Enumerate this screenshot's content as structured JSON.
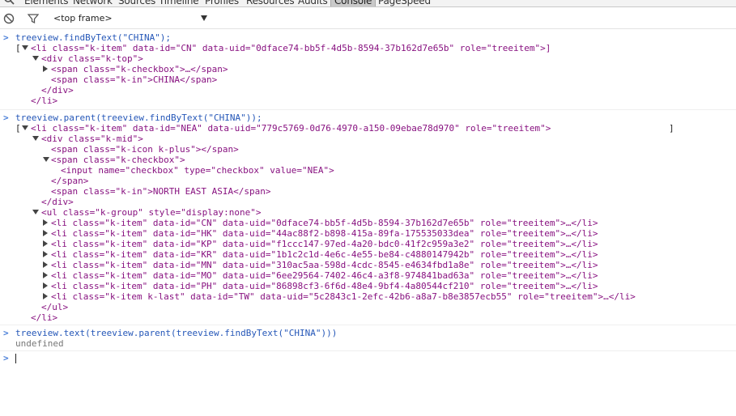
{
  "tabs": [
    "Elements",
    "Network",
    "Sources",
    "Timeline",
    "Profiles",
    "Resources",
    "Audits",
    "Console",
    "PageSpeed"
  ],
  "active_tab": "Console",
  "toolbar": {
    "frame_select_value": "<top frame>"
  },
  "console": {
    "prompt_symbol": ">",
    "command1": "treeview.findByText(\"CHINA\");",
    "command2": "treeview.parent(treeview.findByText(\"CHINA\"));",
    "command3": "treeview.text(treeview.parent(treeview.findByText(\"CHINA\")))",
    "result3": "undefined",
    "open_bracket": "[",
    "close_bracket": "]",
    "tree1": {
      "li_open": "<li class=\"k-item\" data-id=\"CN\" data-uid=\"0dface74-bb5f-4d5b-8594-37b162d7e65b\" role=\"treeitem\">]",
      "div_open": "<div class=\"k-top\">",
      "checkbox_collapsed": "<span class=\"k-checkbox\">…</span>",
      "span_in": "<span class=\"k-in\">CHINA</span>",
      "div_close": "</div>",
      "li_close": "</li>"
    },
    "tree2": {
      "li_open": "<li class=\"k-item\" data-id=\"NEA\" data-uid=\"779c5769-0d76-4970-a150-09ebae78d970\" role=\"treeitem\">",
      "div_open": "<div class=\"k-mid\">",
      "span_icon": "<span class=\"k-icon k-plus\"></span>",
      "span_checkbox_open": "<span class=\"k-checkbox\">",
      "input": "<input name=\"checkbox\" type=\"checkbox\" value=\"NEA\">",
      "span_close": "</span>",
      "span_in": "<span class=\"k-in\">NORTH EAST ASIA</span>",
      "div_close": "</div>",
      "ul_open": "<ul class=\"k-group\" style=\"display:none\">",
      "children": [
        "<li class=\"k-item\" data-id=\"CN\" data-uid=\"0dface74-bb5f-4d5b-8594-37b162d7e65b\" role=\"treeitem\">…</li>",
        "<li class=\"k-item\" data-id=\"HK\" data-uid=\"44ac88f2-b898-415a-89fa-175535033dea\" role=\"treeitem\">…</li>",
        "<li class=\"k-item\" data-id=\"KP\" data-uid=\"f1ccc147-97ed-4a20-bdc0-41f2c959a3e2\" role=\"treeitem\">…</li>",
        "<li class=\"k-item\" data-id=\"KR\" data-uid=\"1b1c2c1d-4e6c-4e55-be84-c4880147942b\" role=\"treeitem\">…</li>",
        "<li class=\"k-item\" data-id=\"MN\" data-uid=\"310ac5aa-598d-4cdc-8545-e4634fbd1a8e\" role=\"treeitem\">…</li>",
        "<li class=\"k-item\" data-id=\"MO\" data-uid=\"6ee29564-7402-46c4-a3f8-974841bad63a\" role=\"treeitem\">…</li>",
        "<li class=\"k-item\" data-id=\"PH\" data-uid=\"86898cf3-6f6d-48e4-9bf4-4a80544cf210\" role=\"treeitem\">…</li>",
        "<li class=\"k-item k-last\" data-id=\"TW\" data-uid=\"5c2843c1-2efc-42b6-a8a7-b8e3857ecb55\" role=\"treeitem\">…</li>"
      ],
      "ul_close": "</ul>",
      "li_close": "</li>"
    }
  },
  "colors": {
    "command": "#2557b8",
    "tag": "#881280",
    "attr": "#994500",
    "value": "#1a1aa6",
    "prompt": "#4a7fd8"
  },
  "icons": [
    "search-icon",
    "clear-console-icon",
    "filter-icon"
  ]
}
